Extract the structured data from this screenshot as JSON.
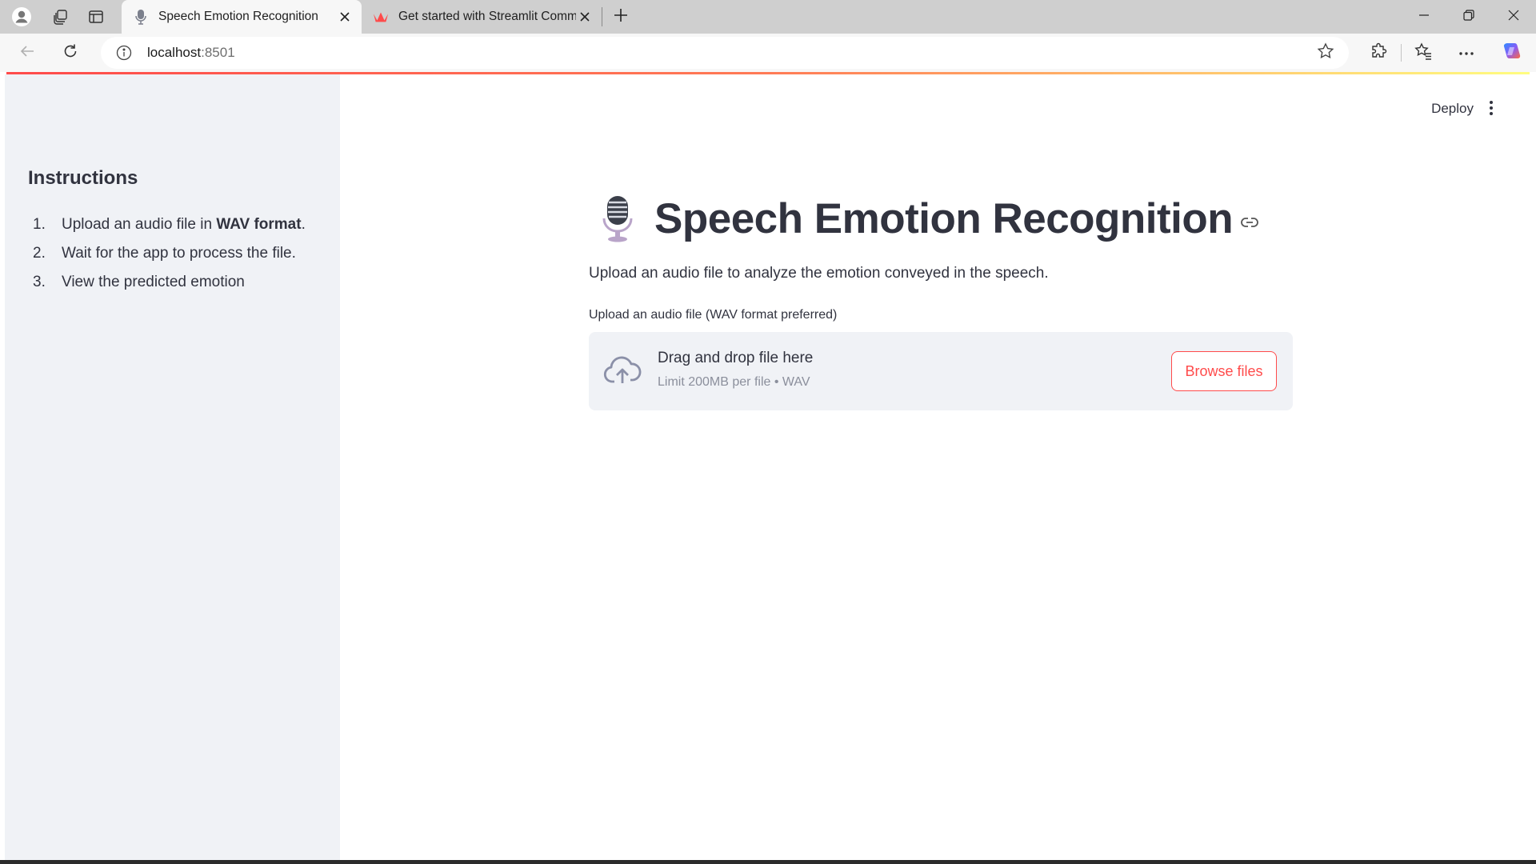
{
  "browser": {
    "tabs": [
      {
        "title": "Speech Emotion Recognition",
        "active": true,
        "favicon": "microphone-icon"
      },
      {
        "title": "Get started with Streamlit Commu",
        "active": false,
        "favicon": "streamlit-crown-icon"
      }
    ],
    "address": {
      "host": "localhost",
      "port": ":8501"
    }
  },
  "sidebar": {
    "heading": "Instructions",
    "steps": [
      {
        "num": "1.",
        "text_before": "Upload an audio file in ",
        "bold": "WAV format",
        "text_after": "."
      },
      {
        "num": "2.",
        "text": "Wait for the app to process the file."
      },
      {
        "num": "3.",
        "text": "View the predicted emotion"
      }
    ]
  },
  "header": {
    "deploy_label": "Deploy"
  },
  "main": {
    "title": "Speech Emotion Recognition",
    "subtitle": "Upload an audio file to analyze the emotion conveyed in the speech.",
    "uploader": {
      "label": "Upload an audio file (WAV format preferred)",
      "drop_text": "Drag and drop file here",
      "limit_text": "Limit 200MB per file • WAV",
      "button_label": "Browse files"
    }
  },
  "colors": {
    "accent": "#ff4b4b",
    "sidebar_bg": "#f0f2f6",
    "text": "#31333f"
  }
}
